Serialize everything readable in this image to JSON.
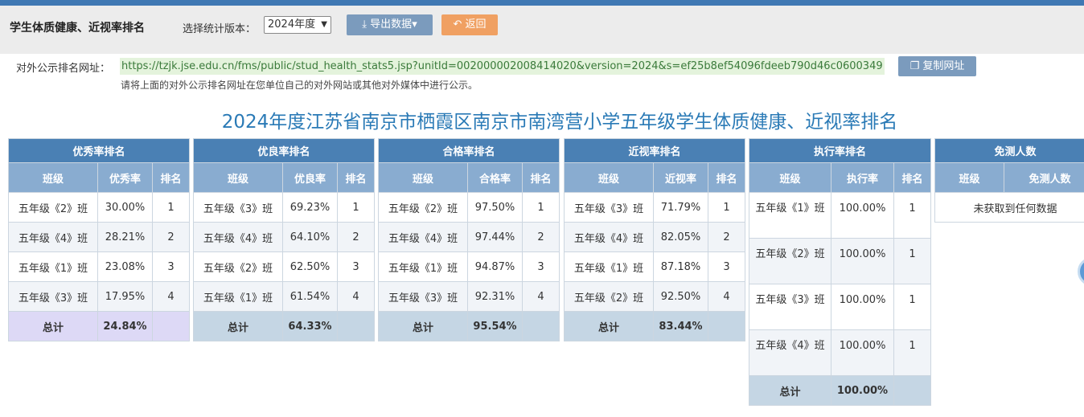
{
  "header": {
    "title": "学生体质健康、近视率排名",
    "version_label": "选择统计版本：",
    "version_selected": "2024年度",
    "export_label": "导出数据",
    "back_label": "返回"
  },
  "public_url": {
    "label": "对外公示排名网址：",
    "value": "https://tzjk.jse.edu.cn/fms/public/stud_health_stats5.jsp?unitId=002000002008414020&version=2024&s=ef25b8ef54096fdeeb790d46c0600349",
    "copy_label": "复制网址",
    "hint": "请将上面的对外公示排名网址在您单位自己的对外网站或其他对外媒体中进行公示。"
  },
  "main_title": "2024年度江苏省南京市栖霞区南京市南湾营小学五年级学生体质健康、近视率排名",
  "tables": [
    {
      "title": "优秀率排名",
      "cols": [
        "班级",
        "优秀率",
        "排名"
      ],
      "rows": [
        [
          "五年级《2》班",
          "30.00%",
          "1"
        ],
        [
          "五年级《4》班",
          "28.21%",
          "2"
        ],
        [
          "五年级《1》班",
          "23.08%",
          "3"
        ],
        [
          "五年级《3》班",
          "17.95%",
          "4"
        ]
      ],
      "total_label": "总计",
      "total_value": "24.84%"
    },
    {
      "title": "优良率排名",
      "cols": [
        "班级",
        "优良率",
        "排名"
      ],
      "rows": [
        [
          "五年级《3》班",
          "69.23%",
          "1"
        ],
        [
          "五年级《4》班",
          "64.10%",
          "2"
        ],
        [
          "五年级《2》班",
          "62.50%",
          "3"
        ],
        [
          "五年级《1》班",
          "61.54%",
          "4"
        ]
      ],
      "total_label": "总计",
      "total_value": "64.33%"
    },
    {
      "title": "合格率排名",
      "cols": [
        "班级",
        "合格率",
        "排名"
      ],
      "rows": [
        [
          "五年级《2》班",
          "97.50%",
          "1"
        ],
        [
          "五年级《4》班",
          "97.44%",
          "2"
        ],
        [
          "五年级《1》班",
          "94.87%",
          "3"
        ],
        [
          "五年级《3》班",
          "92.31%",
          "4"
        ]
      ],
      "total_label": "总计",
      "total_value": "95.54%"
    },
    {
      "title": "近视率排名",
      "cols": [
        "班级",
        "近视率",
        "排名"
      ],
      "rows": [
        [
          "五年级《3》班",
          "71.79%",
          "1"
        ],
        [
          "五年级《4》班",
          "82.05%",
          "2"
        ],
        [
          "五年级《1》班",
          "87.18%",
          "3"
        ],
        [
          "五年级《2》班",
          "92.50%",
          "4"
        ]
      ],
      "total_label": "总计",
      "total_value": "83.44%"
    },
    {
      "title": "执行率排名",
      "cols": [
        "班级",
        "执行率",
        "排名"
      ],
      "rows": [
        [
          "五年级《1》班",
          "100.00%",
          "1"
        ],
        [
          "五年级《2》班",
          "100.00%",
          "1"
        ],
        [
          "五年级《3》班",
          "100.00%",
          "1"
        ],
        [
          "五年级《4》班",
          "100.00%",
          "1"
        ]
      ],
      "total_label": "总计",
      "total_value": "100.00%"
    },
    {
      "title": "免测人数",
      "cols": [
        "班级",
        "免测人数"
      ],
      "empty_text": "未获取到任何数据"
    }
  ]
}
